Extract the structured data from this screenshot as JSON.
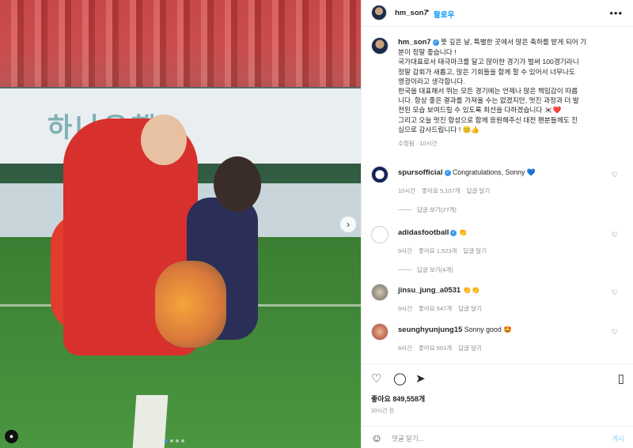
{
  "header": {
    "username": "hm_son7",
    "follow_label": "팔로우",
    "more_icon": "more-horizontal-icon"
  },
  "caption": {
    "username": "hm_son7",
    "lines": [
      "뜻 깊은 날, 특별한 곳에서 많은 축하를 받게 되어 기",
      "분이 정말 좋습니다 !",
      "국가대표로서 태극마크를 달고 많이한 경기가 벌써 100경기라니",
      "정말 감회가 새롭고, 많은 기회들을 함께 할 수 있어서 너무나도",
      "영광이라고 생각합니다.",
      "한국을 대표해서 뛰는 모든 경기에는 언제나 많은 책임감이 따릅",
      "니다. 항상 좋은 결과를 가져올 수는 없겠지만, 멋진 과정과 더 발",
      "전된 모습 보여드릴 수 있도록 최선을 다하겠습니다 🇰🇷❤️",
      "그리고 오늘 멋진 함성으로 함께 응원해주신 대전 팬분들께도 진",
      "심으로 감사드립니다 ! 😊👍"
    ],
    "meta": "수정됨 · 10시간"
  },
  "comments": [
    {
      "username": "spursofficial",
      "verified": true,
      "text": "Congratulations, Sonny 💙",
      "time": "10시간",
      "likes": "좋아요 5,107개",
      "reply": "답글 달기",
      "replies": "답글 보기(27개)"
    },
    {
      "username": "adidasfootball",
      "verified": true,
      "text": "👏",
      "time": "9시간",
      "likes": "좋아요 1,523개",
      "reply": "답글 달기",
      "replies": "답글 보기(4개)"
    },
    {
      "username": "jinsu_jung_a0531",
      "verified": false,
      "text": "👏👏",
      "time": "9시간",
      "likes": "좋아요 547개",
      "reply": "답글 달기",
      "replies": ""
    },
    {
      "username": "seunghyunjung15",
      "verified": false,
      "text": "Sonny good 🤩",
      "time": "8시간",
      "likes": "좋아요 501개",
      "reply": "답글 달기",
      "replies": ""
    }
  ],
  "actions": {
    "likes": "좋아요 849,558개",
    "time": "10시간 전"
  },
  "add_comment": {
    "placeholder": "댓글 달기...",
    "post_label": "게시"
  },
  "media": {
    "board_text": "하나은행"
  }
}
